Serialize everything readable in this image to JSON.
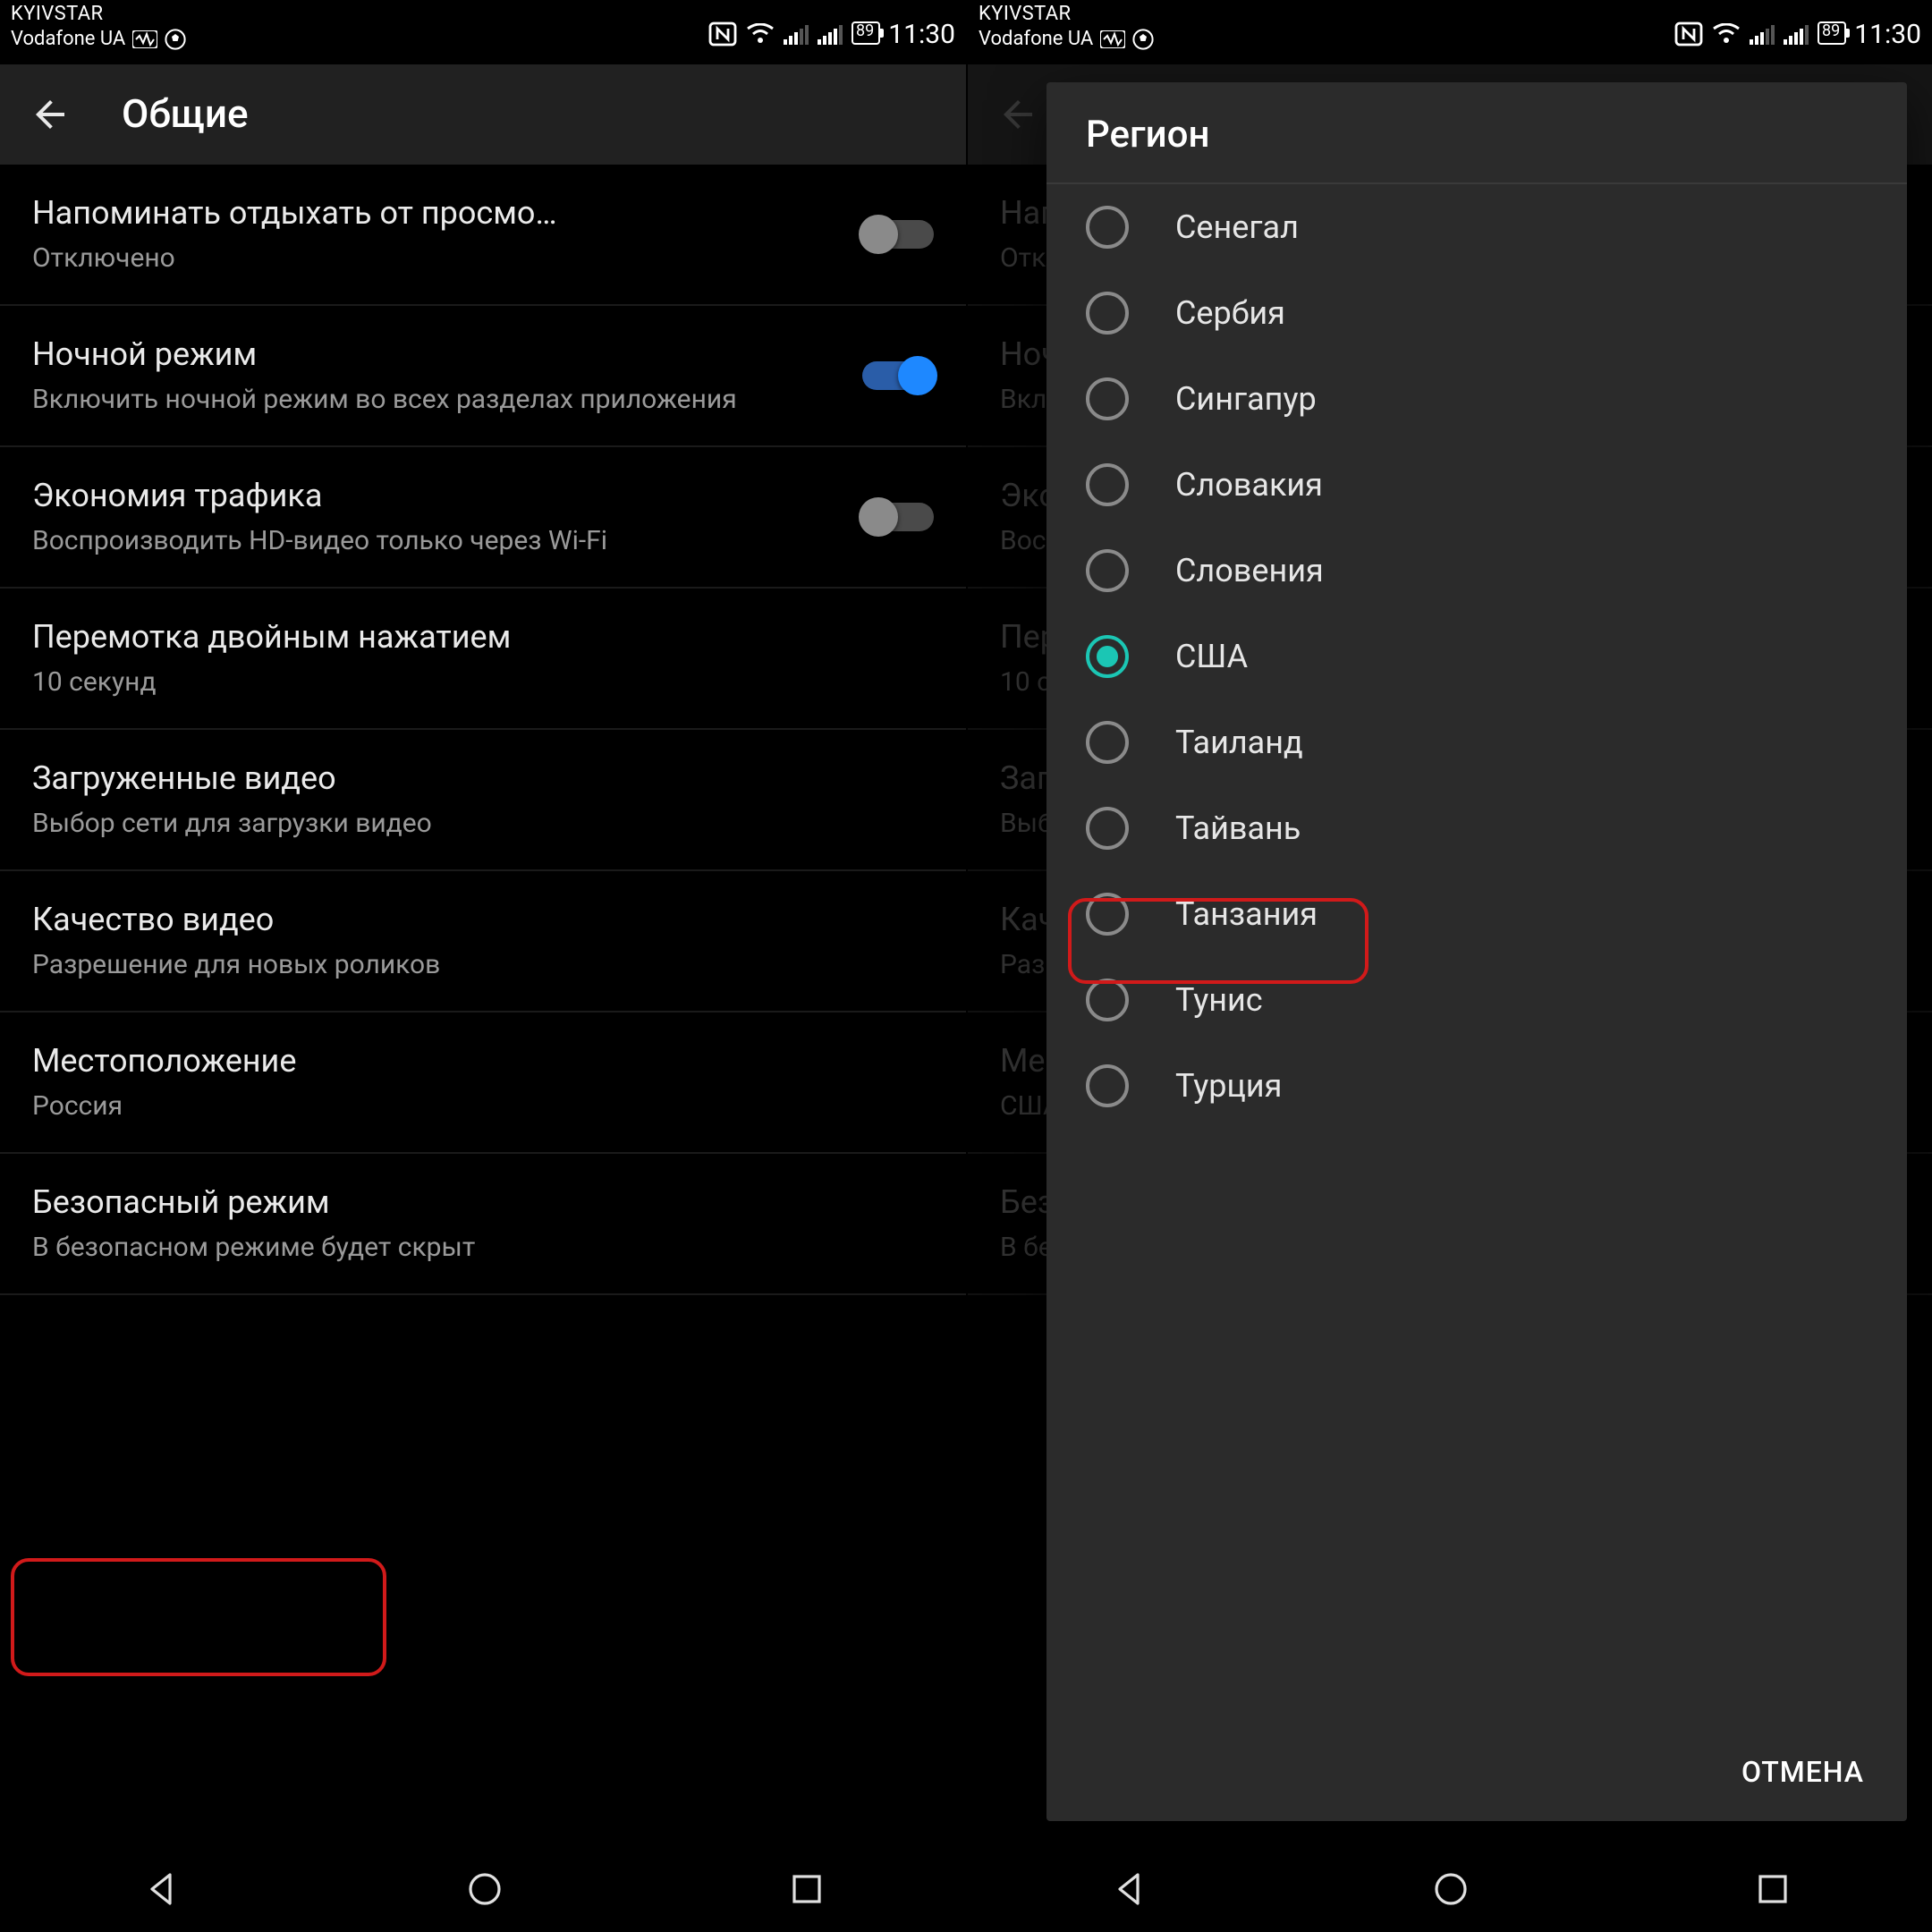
{
  "status": {
    "carrier1": "KYIVSTAR",
    "carrier2": "Vodafone UA",
    "battery": "89",
    "time": "11:30"
  },
  "appbar": {
    "title": "Общие"
  },
  "settings": [
    {
      "title": "Напоминать отдыхать от просмо…",
      "sub": "Отключено",
      "toggle": "off"
    },
    {
      "title": "Ночной режим",
      "sub": "Включить ночной режим во всех разделах приложения",
      "toggle": "on"
    },
    {
      "title": "Экономия трафика",
      "sub": "Воспроизводить HD-видео только через Wi-Fi",
      "toggle": "off"
    },
    {
      "title": "Перемотка двойным нажатием",
      "sub": "10 секунд"
    },
    {
      "title": "Загруженные видео",
      "sub": "Выбор сети для загрузки видео"
    },
    {
      "title": "Качество видео",
      "sub": "Разрешение для новых роликов"
    },
    {
      "title": "Местоположение",
      "sub": "Россия"
    },
    {
      "title": "Безопасный режим",
      "sub": "В безопасном режиме будет скрыт"
    }
  ],
  "settings_right_location_sub": "США",
  "dialog": {
    "title": "Регион",
    "cancel": "ОТМЕНА",
    "options": [
      "Сенегал",
      "Сербия",
      "Сингапур",
      "Словакия",
      "Словения",
      "США",
      "Таиланд",
      "Тайвань",
      "Танзания",
      "Тунис",
      "Турция"
    ],
    "selected_index": 5
  }
}
